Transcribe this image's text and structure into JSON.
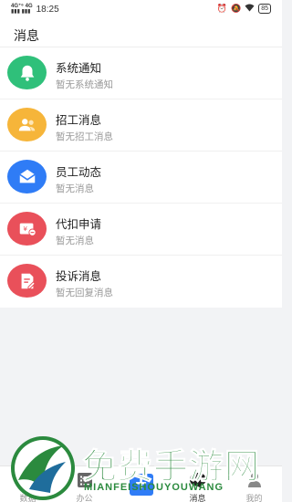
{
  "status_bar": {
    "signal_top": "4G⁺⁶ 4G",
    "signal_bottom": "▮▮▮ ▮▮▮",
    "time": "18:25",
    "battery": "85"
  },
  "header": {
    "title": "消息"
  },
  "messages": [
    {
      "title": "系统通知",
      "subtitle": "暂无系统通知",
      "icon": "bell-icon",
      "color": "#2fc07a"
    },
    {
      "title": "招工消息",
      "subtitle": "暂无招工消息",
      "icon": "people-icon",
      "color": "#f6b53a"
    },
    {
      "title": "员工动态",
      "subtitle": "暂无消息",
      "icon": "mail-icon",
      "color": "#2f7cf6"
    },
    {
      "title": "代扣申请",
      "subtitle": "暂无消息",
      "icon": "money-card-icon",
      "color": "#e9505a"
    },
    {
      "title": "投诉消息",
      "subtitle": "暂无回复消息",
      "icon": "complaint-icon",
      "color": "#e9505a"
    }
  ],
  "tabs": [
    {
      "label": "数据",
      "icon": "chart-icon"
    },
    {
      "label": "办公",
      "icon": "checklist-icon"
    },
    {
      "label": "",
      "icon": "plus-icon"
    },
    {
      "label": "消息",
      "icon": "chat-icon",
      "active": true
    },
    {
      "label": "我的",
      "icon": "user-icon"
    }
  ],
  "watermark": {
    "text": "免费手游网",
    "subtext": "MIANFEISHOUYOUWANG"
  }
}
